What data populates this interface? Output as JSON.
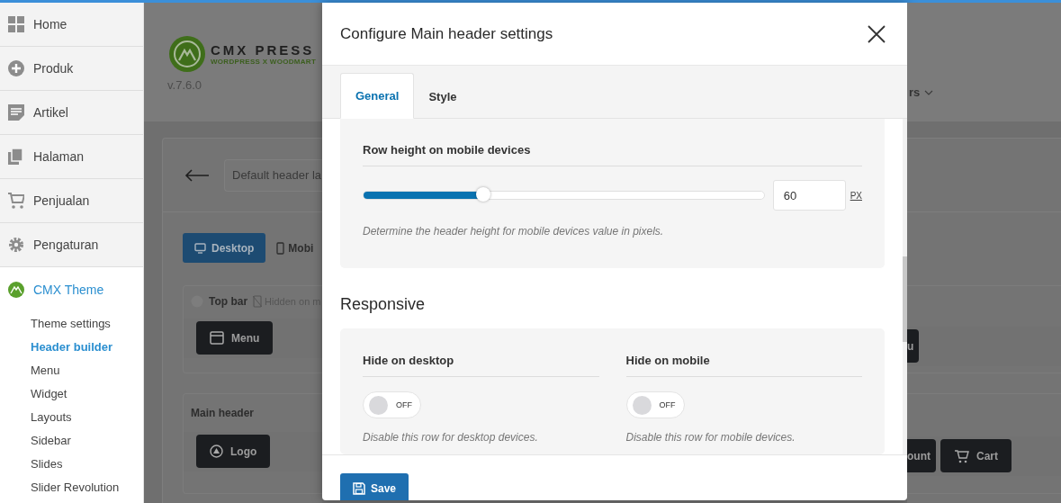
{
  "sidebar": {
    "items": [
      {
        "label": "Home",
        "selected": false
      },
      {
        "label": "Produk",
        "selected": false
      },
      {
        "label": "Artikel",
        "selected": false
      },
      {
        "label": "Halaman",
        "selected": false
      },
      {
        "label": "Penjualan",
        "selected": false
      },
      {
        "label": "Pengaturan",
        "selected": false
      },
      {
        "label": "CMX Theme",
        "selected": true,
        "children": [
          {
            "label": "Theme settings",
            "selected": false
          },
          {
            "label": "Header builder",
            "selected": true
          },
          {
            "label": "Menu",
            "selected": false
          },
          {
            "label": "Widget",
            "selected": false
          },
          {
            "label": "Layouts",
            "selected": false
          },
          {
            "label": "Sidebar",
            "selected": false
          },
          {
            "label": "Slides",
            "selected": false
          },
          {
            "label": "Slider Revolution",
            "selected": false
          }
        ]
      }
    ]
  },
  "background_page": {
    "logo_text": "CMX PRESS",
    "logo_tagline": "WORDPRESS X WOODMART",
    "version": "v.7.6.0",
    "layout_field": "Default header la",
    "menu_label": "rs",
    "device_tabs": [
      {
        "label": "Desktop",
        "selected": true
      },
      {
        "label": "Mobi",
        "selected": false
      }
    ],
    "top_bar": {
      "title": "Top bar",
      "note": "Hidden on m",
      "elements": [
        "Menu",
        "u"
      ]
    },
    "main_header": {
      "title": "Main header",
      "elements": [
        "Logo",
        "ount",
        "Cart"
      ]
    }
  },
  "modal": {
    "title": "Configure Main header settings",
    "tabs": [
      {
        "label": "General",
        "selected": true
      },
      {
        "label": "Style",
        "selected": false
      }
    ],
    "row_height": {
      "label": "Row height on mobile devices",
      "level": 0.3,
      "value": "60",
      "unit": "PX",
      "help": "Determine the header height for mobile devices value in pixels."
    },
    "responsive": {
      "title": "Responsive",
      "options": [
        {
          "label": "Hide on desktop",
          "on": false,
          "state_text": "OFF",
          "help": "Disable this row for desktop devices."
        },
        {
          "label": "Hide on mobile",
          "on": false,
          "state_text": "OFF",
          "help": "Disable this row for mobile devices."
        }
      ]
    },
    "save_button": "Save"
  }
}
